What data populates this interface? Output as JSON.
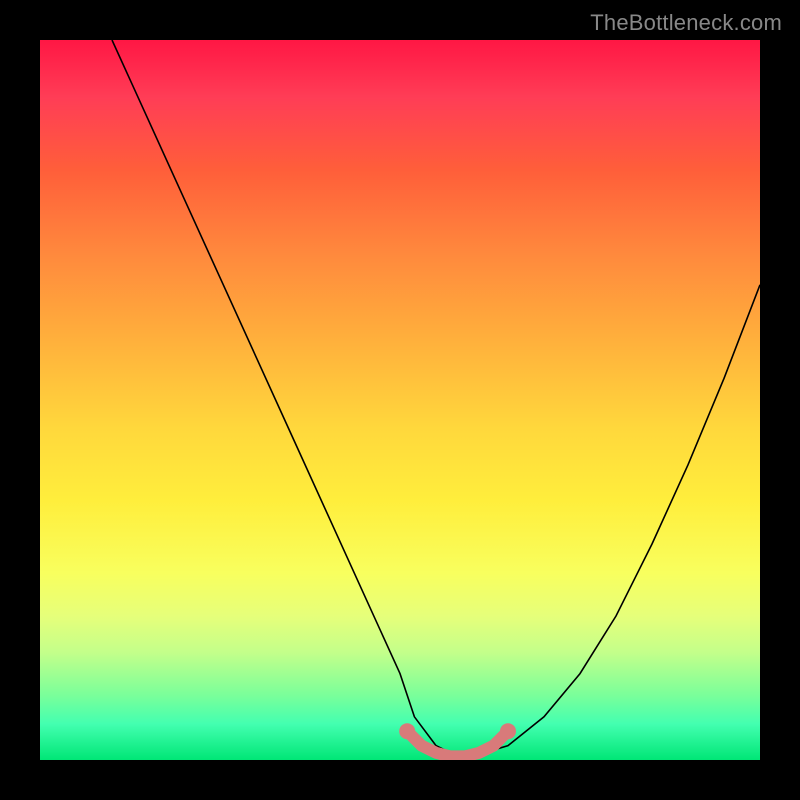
{
  "watermark": "TheBottleneck.com",
  "chart_data": {
    "type": "line",
    "title": "",
    "xlabel": "",
    "ylabel": "",
    "xlim": [
      0,
      100
    ],
    "ylim": [
      0,
      100
    ],
    "series": [
      {
        "name": "bottleneck-curve",
        "x": [
          10,
          15,
          20,
          25,
          30,
          35,
          40,
          45,
          50,
          52,
          55,
          58,
          60,
          65,
          70,
          75,
          80,
          85,
          90,
          95,
          100
        ],
        "y": [
          100,
          89,
          78,
          67,
          56,
          45,
          34,
          23,
          12,
          6,
          2,
          0.5,
          0.5,
          2,
          6,
          12,
          20,
          30,
          41,
          53,
          66
        ]
      },
      {
        "name": "optimal-zone-marker",
        "x": [
          51,
          53,
          55,
          57,
          59,
          61,
          63,
          65
        ],
        "y": [
          4,
          2,
          1,
          0.5,
          0.5,
          1,
          2,
          4
        ]
      }
    ],
    "background_gradient": {
      "top_color": "#ff1744",
      "mid_color": "#ffee3c",
      "bottom_color": "#00e676"
    }
  }
}
